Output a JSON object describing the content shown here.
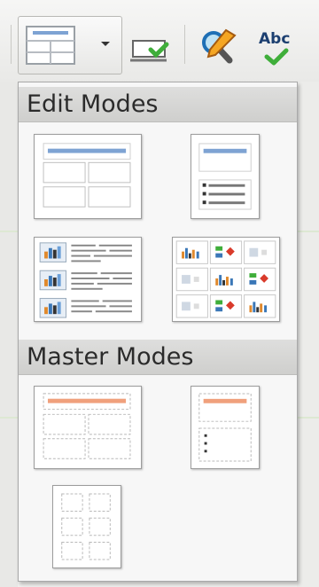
{
  "toolbar": {
    "buttons": [
      {
        "icon": "display-views-icon"
      },
      {
        "icon": "dropdown-arrow-icon"
      },
      {
        "icon": "master-slide-icon"
      },
      {
        "icon": "find-replace-icon"
      },
      {
        "icon": "spellcheck-icon",
        "label": "Abc"
      }
    ]
  },
  "popup": {
    "edit_modes_title": "Edit Modes",
    "master_modes_title": "Master Modes",
    "edit_modes": [
      {
        "icon": "normal-view-icon"
      },
      {
        "icon": "outline-view-icon"
      },
      {
        "icon": "notes-view-icon"
      },
      {
        "icon": "slide-sorter-icon"
      }
    ],
    "master_modes": [
      {
        "icon": "master-slide-view-icon"
      },
      {
        "icon": "master-notes-view-icon"
      },
      {
        "icon": "master-handout-view-icon"
      }
    ]
  },
  "colors": {
    "accent_blue": "#7ea3d3",
    "accent_orange": "#f0a07c",
    "check_green": "#3fae3a"
  }
}
